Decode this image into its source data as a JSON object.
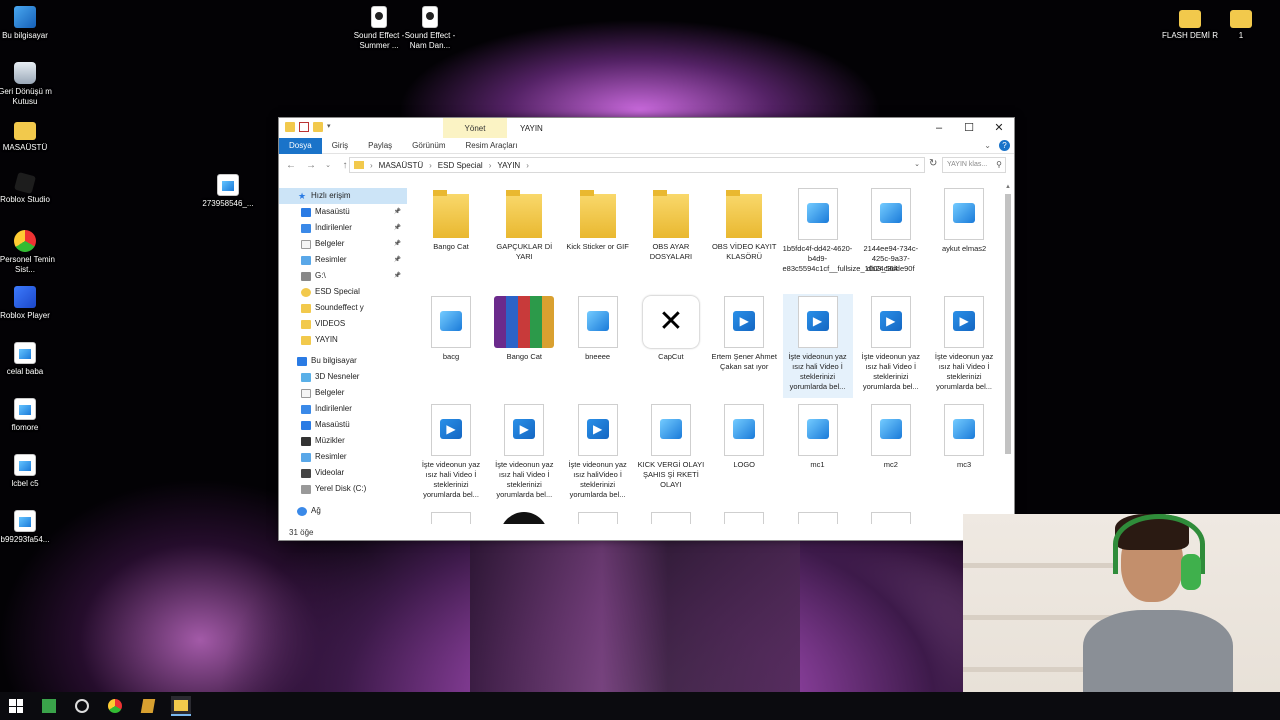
{
  "desktop": {
    "icons_left": [
      {
        "label": "Bu bilgisayar",
        "icon": "this-pc-icon"
      },
      {
        "label": "Geri Dönüşü m Kutusu",
        "icon": "recycle-bin-icon"
      },
      {
        "label": "MASAÜSTÜ",
        "icon": "folder-icon"
      },
      {
        "label": "Roblox Studio",
        "icon": "roblox-studio-icon"
      },
      {
        "label": "- Personel Temin Sist...",
        "icon": "chrome-shortcut-icon"
      },
      {
        "label": "Roblox Player",
        "icon": "roblox-player-icon"
      },
      {
        "label": "celal baba",
        "icon": "image-file-icon"
      },
      {
        "label": "flomore",
        "icon": "image-file-icon"
      },
      {
        "label": "lcbel c5",
        "icon": "image-file-icon"
      },
      {
        "label": "b99293fa54...",
        "icon": "image-file-icon"
      }
    ],
    "icon_mid": {
      "label": "273958546_...",
      "icon": "image-file-icon"
    },
    "icons_top": [
      {
        "label": "Sound Effect - Summer ...",
        "icon": "media-file-icon"
      },
      {
        "label": "Sound Effect - Nam Dan...",
        "icon": "media-file-icon"
      }
    ],
    "icons_right": [
      {
        "label": "FLASH DEMİ R",
        "icon": "folder-icon"
      },
      {
        "label": "1",
        "icon": "folder-icon"
      }
    ]
  },
  "explorer": {
    "manage_tab": "Yönet",
    "title": "YAYIN",
    "ribbon_tabs": [
      "Dosya",
      "Giriş",
      "Paylaş",
      "Görünüm",
      "Resim Araçları"
    ],
    "breadcrumb": [
      "MASAÜSTÜ",
      "ESD Special",
      "YAYIN"
    ],
    "search_placeholder": "YAYIN klas...",
    "nav": {
      "quick_access": "Hızlı erişim",
      "quick_items": [
        {
          "label": "Masaüstü",
          "icon": "desktop-icon",
          "pinned": true
        },
        {
          "label": "İndirilenler",
          "icon": "downloads-icon",
          "pinned": true
        },
        {
          "label": "Belgeler",
          "icon": "documents-icon",
          "pinned": true
        },
        {
          "label": "Resimler",
          "icon": "pictures-icon",
          "pinned": true
        },
        {
          "label": "G:\\",
          "icon": "drive-icon",
          "pinned": true
        },
        {
          "label": "ESD Special",
          "icon": "shield-folder-icon",
          "pinned": false
        },
        {
          "label": "Soundeffect y",
          "icon": "folder-icon",
          "pinned": false
        },
        {
          "label": "VIDEOS",
          "icon": "folder-icon",
          "pinned": false
        },
        {
          "label": "YAYIN",
          "icon": "folder-icon",
          "pinned": false
        }
      ],
      "this_pc": "Bu bilgisayar",
      "pc_items": [
        {
          "label": "3D Nesneler",
          "icon": "3d-objects-icon"
        },
        {
          "label": "Belgeler",
          "icon": "documents-icon"
        },
        {
          "label": "İndirilenler",
          "icon": "downloads-icon"
        },
        {
          "label": "Masaüstü",
          "icon": "desktop-icon"
        },
        {
          "label": "Müzikler",
          "icon": "music-icon"
        },
        {
          "label": "Resimler",
          "icon": "pictures-icon"
        },
        {
          "label": "Videolar",
          "icon": "videos-icon"
        },
        {
          "label": "Yerel Disk (C:)",
          "icon": "local-disk-icon"
        }
      ],
      "network": "Ağ"
    },
    "files": [
      {
        "label": "Bango Cat",
        "type": "folder"
      },
      {
        "label": "GAPÇUKLAR Dİ YARI",
        "type": "folder"
      },
      {
        "label": "Kick Sticker or GIF",
        "type": "folder"
      },
      {
        "label": "OBS AYAR DOSYALARI",
        "type": "folder"
      },
      {
        "label": "OBS VİDEO KAYIT KLASÖRÜ",
        "type": "folder"
      },
      {
        "label": "1b5fdc4f-dd42-4620-b4d9-e83c5594c1cf__fullsize_1003_564",
        "type": "image"
      },
      {
        "label": "2144ee94-734c-425c-9a37-db24c3dde90f",
        "type": "image"
      },
      {
        "label": "aykut elmas2",
        "type": "image"
      },
      {
        "label": "bacg",
        "type": "image"
      },
      {
        "label": "Bango Cat",
        "type": "rar"
      },
      {
        "label": "bneeee",
        "type": "image"
      },
      {
        "label": "CapCut",
        "type": "capcut"
      },
      {
        "label": "Ertem Şener Ahmet Çakan sat ıyor",
        "type": "video"
      },
      {
        "label": "İşte videonun yaz ısız hali Video İ steklerinizi yorumlarda bel...",
        "type": "video"
      },
      {
        "label": "İşte videonun yaz ısız hali Video İ steklerinizi yorumlarda bel...",
        "type": "video"
      },
      {
        "label": "İşte videonun yaz ısız hali Video İ steklerinizi yorumlarda bel...",
        "type": "video"
      },
      {
        "label": "İşte videonun yaz ısız hali Video İ steklerinizi yorumlarda bel...",
        "type": "video"
      },
      {
        "label": "İşte videonun yaz ısız hali Video İ steklerinizi yorumlarda bel...",
        "type": "video"
      },
      {
        "label": "İşte videonun yaz ısız haliVideo İ steklerinizi yorumlarda bel...",
        "type": "video"
      },
      {
        "label": "KICK VERGİ OLAYI ŞAHIS Şİ RKETİ OLAYI",
        "type": "image"
      },
      {
        "label": "LOGO",
        "type": "image"
      },
      {
        "label": "mc1",
        "type": "image"
      },
      {
        "label": "mc2",
        "type": "image"
      },
      {
        "label": "mc3",
        "type": "image"
      }
    ],
    "status": "31 öğe"
  }
}
